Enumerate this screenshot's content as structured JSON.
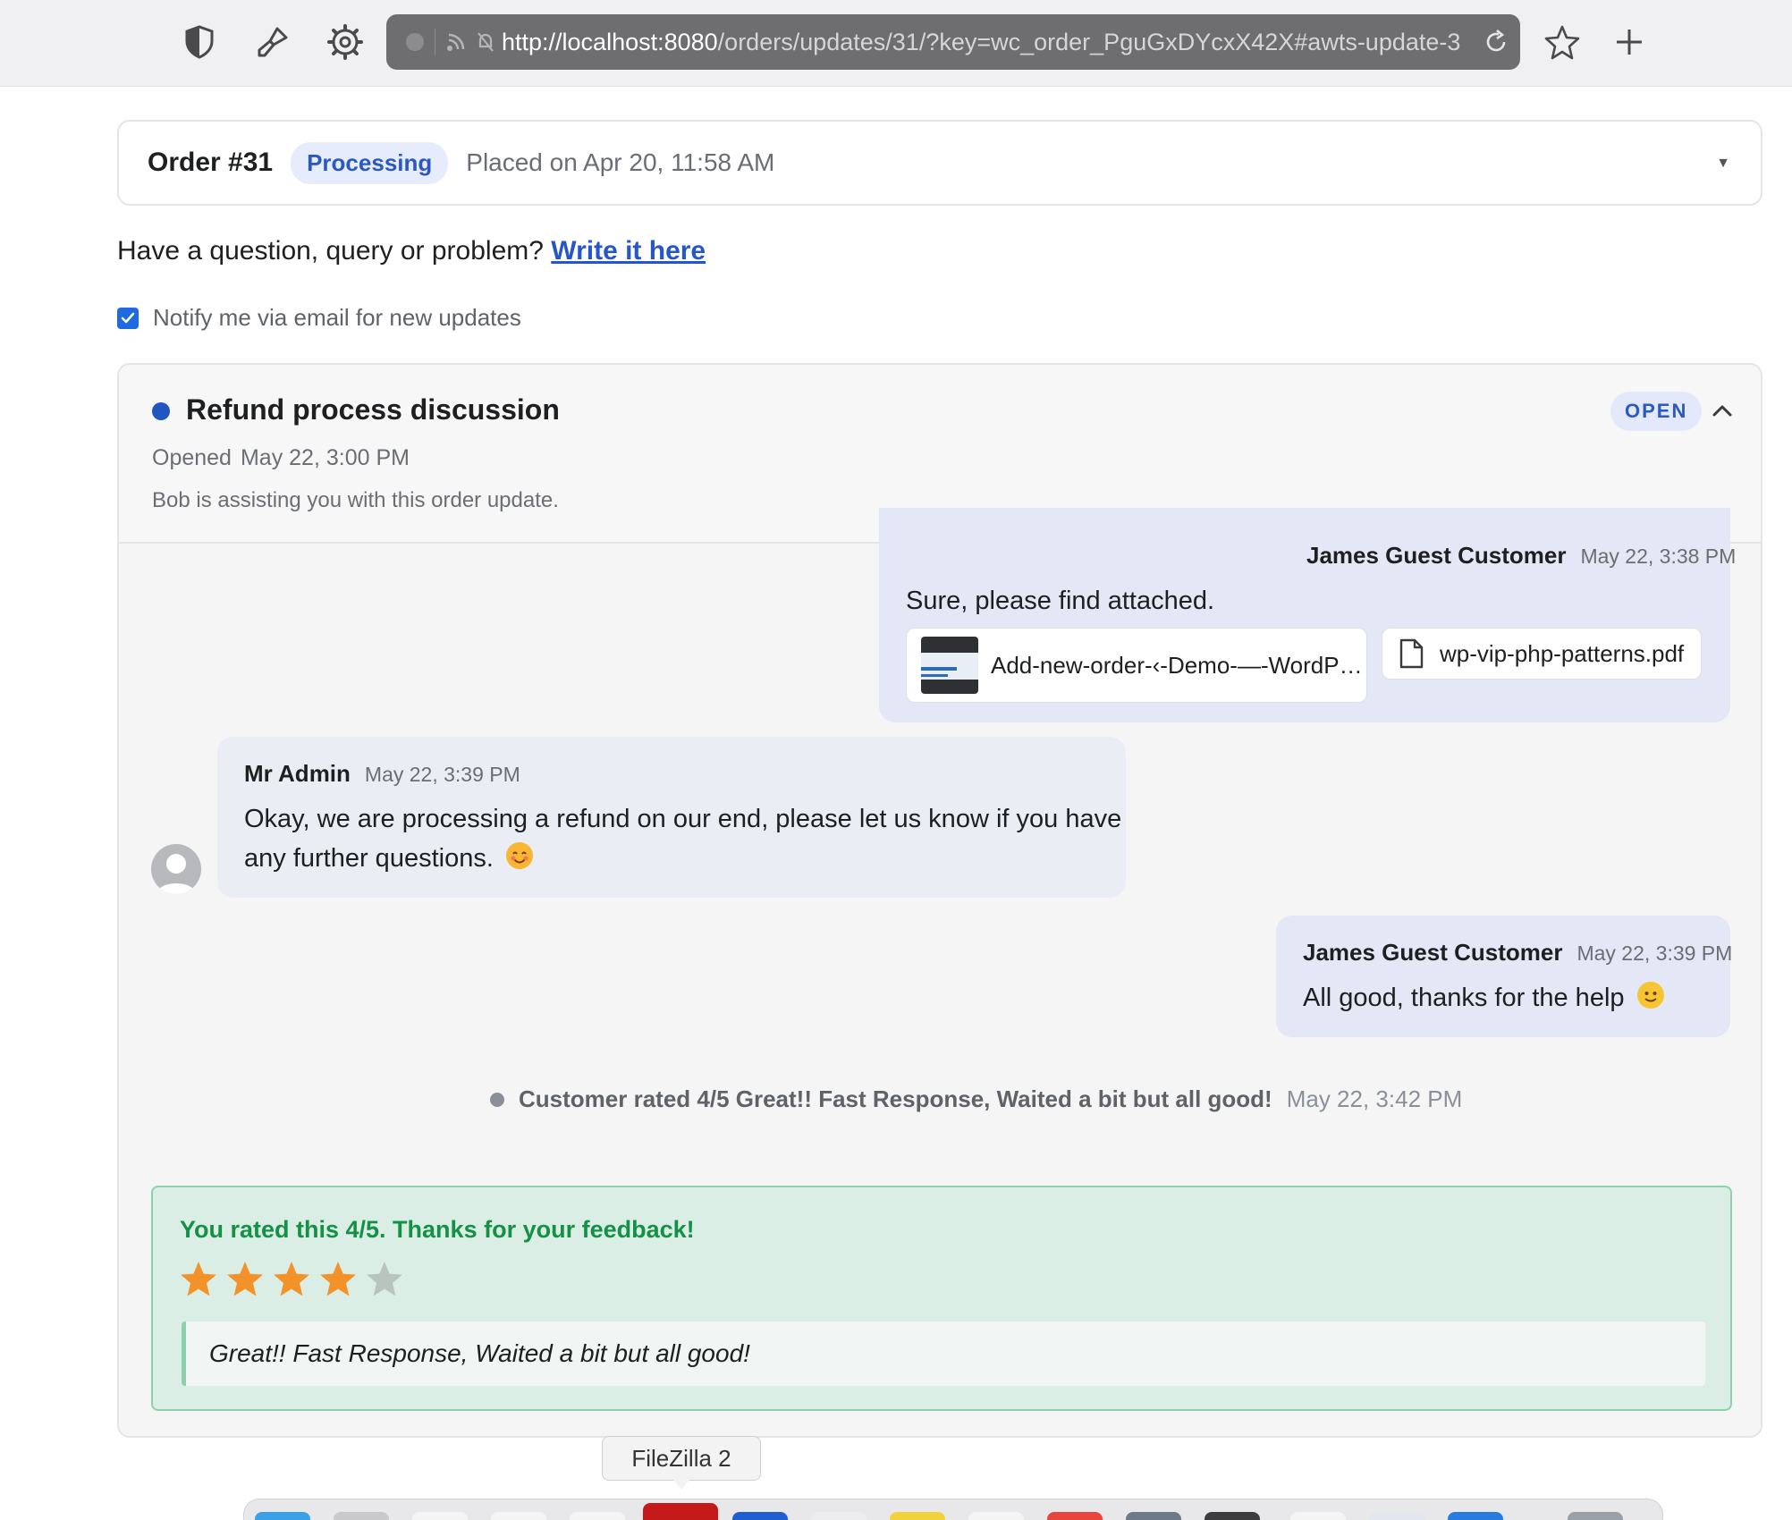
{
  "browser": {
    "url_host": "http://localhost:8080",
    "url_path": "/orders/updates/31/?key=wc_order_PguGxDYcxX42X#awts-update-3",
    "icons": [
      "shield-icon",
      "brush-icon",
      "gear-icon",
      "rss-icon",
      "bell-off-icon",
      "reload-icon",
      "star-icon",
      "plus-icon"
    ]
  },
  "order": {
    "title": "Order #31",
    "status": "Processing",
    "placed": "Placed on Apr 20, 11:58 AM"
  },
  "question": {
    "prompt": "Have a question, query or problem?",
    "link": "Write it here"
  },
  "notify": {
    "label": "Notify me via email for new updates",
    "checked": true
  },
  "thread": {
    "title": "Refund process discussion",
    "badge": "OPEN",
    "opened_label": "Opened",
    "opened_date": "May 22, 3:00 PM",
    "assist": "Bob is assisting you with this order update.",
    "messages": [
      {
        "author": "James Guest Customer",
        "time": "May 22, 3:38 PM",
        "text": "Sure, please find attached.",
        "attachments": [
          "Add-new-order-‹-Demo-—-WordPr…",
          "wp-vip-php-patterns.pdf"
        ]
      },
      {
        "author": "Mr Admin",
        "time": "May 22, 3:39 PM",
        "text_line1": "Okay, we are processing a refund on our end, please let us know if you have",
        "text_line2": "any further questions."
      },
      {
        "author": "James Guest Customer",
        "time": "May 22, 3:39 PM",
        "text": "All good, thanks for the help"
      }
    ],
    "system_event": {
      "text": "Customer rated 4/5 Great!! Fast Response, Waited a bit but all good!",
      "time": "May 22, 3:42 PM"
    },
    "rating": {
      "heading": "You rated this 4/5. Thanks for your feedback!",
      "value": 4,
      "max": 5,
      "comment": "Great!! Fast Response, Waited a bit but all good!"
    }
  },
  "dock": {
    "tooltip": "FileZilla 2"
  },
  "colors": {
    "accent": "#2657c9",
    "success": "#159146",
    "star_on": "#f4922a",
    "star_off": "#b9c4bf"
  }
}
